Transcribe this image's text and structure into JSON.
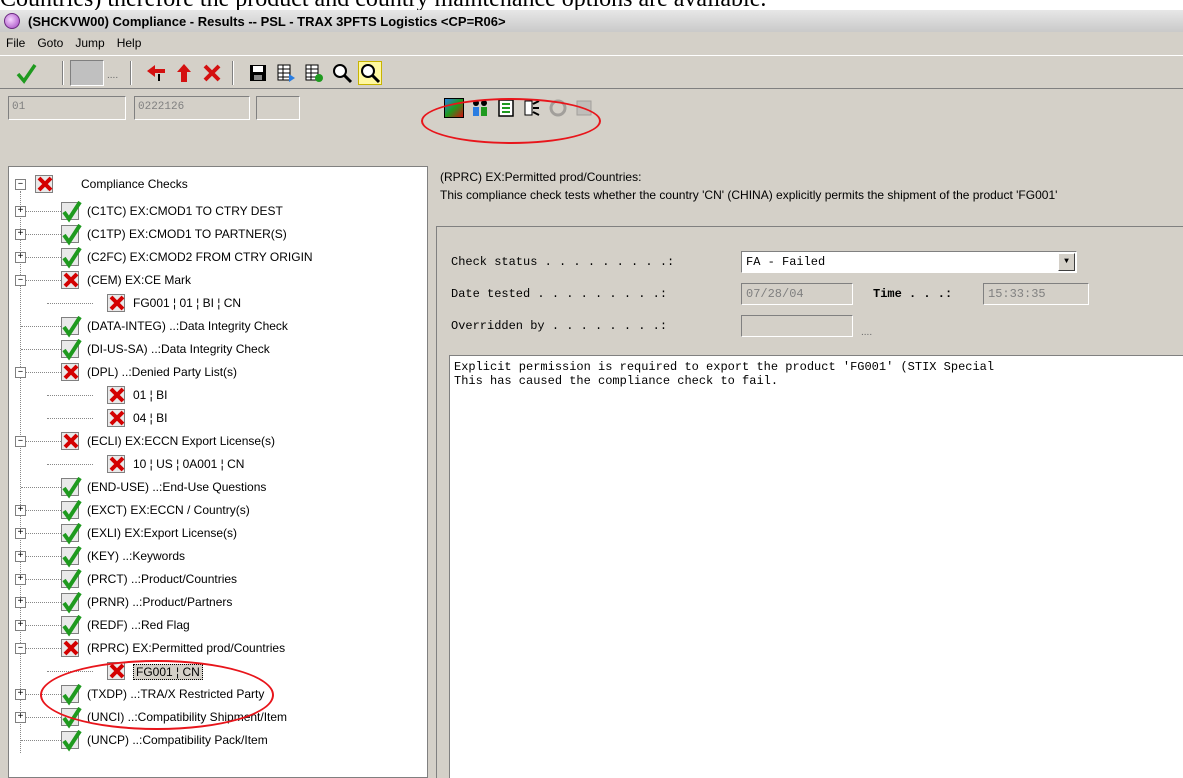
{
  "doc_caption": "Countries) therefore the product and country maintenance options are available.",
  "window": {
    "title": "(SHCKVW00) Compliance - Results -- PSL - TRAX 3PFTS Logistics <CP=R06>"
  },
  "menu": [
    "File",
    "Goto",
    "Jump",
    "Help"
  ],
  "toolbar": {
    "ellipsis": "...."
  },
  "header_fields": {
    "field1": "01",
    "field2": "0222126",
    "field3": ""
  },
  "tree": {
    "root": "Compliance Checks",
    "items": [
      {
        "label": "(C1TC) EX:CMOD1 TO CTRY DEST",
        "status": "pass",
        "expander": "+",
        "depth": 1
      },
      {
        "label": "(C1TP) EX:CMOD1 TO PARTNER(S)",
        "status": "pass",
        "expander": "+",
        "depth": 1
      },
      {
        "label": "(C2FC) EX:CMOD2 FROM CTRY ORIGIN",
        "status": "pass",
        "expander": "+",
        "depth": 1
      },
      {
        "label": "(CEM) EX:CE Mark",
        "status": "fail",
        "expander": "-",
        "depth": 1
      },
      {
        "label": "FG001 ¦ 01 ¦ BI ¦ CN",
        "status": "fail",
        "expander": "",
        "depth": 2
      },
      {
        "label": "(DATA-INTEG) ..:Data Integrity Check",
        "status": "pass",
        "expander": "",
        "depth": 1
      },
      {
        "label": "(DI-US-SA) ..:Data Integrity Check",
        "status": "pass",
        "expander": "",
        "depth": 1
      },
      {
        "label": "(DPL) ..:Denied Party List(s)",
        "status": "fail",
        "expander": "-",
        "depth": 1
      },
      {
        "label": "01 ¦ BI",
        "status": "fail",
        "expander": "",
        "depth": 2
      },
      {
        "label": "04 ¦ BI",
        "status": "fail",
        "expander": "",
        "depth": 2
      },
      {
        "label": "(ECLI) EX:ECCN Export License(s)",
        "status": "fail",
        "expander": "-",
        "depth": 1
      },
      {
        "label": "10 ¦ US ¦ 0A001 ¦ CN",
        "status": "fail",
        "expander": "",
        "depth": 2
      },
      {
        "label": "(END-USE) ..:End-Use Questions",
        "status": "pass",
        "expander": "",
        "depth": 1
      },
      {
        "label": "(EXCT) EX:ECCN / Country(s)",
        "status": "pass",
        "expander": "+",
        "depth": 1
      },
      {
        "label": "(EXLI) EX:Export License(s)",
        "status": "pass",
        "expander": "+",
        "depth": 1
      },
      {
        "label": "(KEY) ..:Keywords",
        "status": "pass",
        "expander": "+",
        "depth": 1
      },
      {
        "label": "(PRCT) ..:Product/Countries",
        "status": "pass",
        "expander": "+",
        "depth": 1
      },
      {
        "label": "(PRNR) ..:Product/Partners",
        "status": "pass",
        "expander": "+",
        "depth": 1
      },
      {
        "label": "(REDF) ..:Red Flag",
        "status": "pass",
        "expander": "+",
        "depth": 1
      },
      {
        "label": "(RPRC) EX:Permitted prod/Countries",
        "status": "fail",
        "expander": "-",
        "depth": 1
      },
      {
        "label": "FG001 ¦ CN",
        "status": "fail",
        "expander": "",
        "depth": 2,
        "selected": true
      },
      {
        "label": "(TXDP) ..:TRA/X Restricted Party",
        "status": "pass",
        "expander": "+",
        "depth": 1
      },
      {
        "label": "(UNCI) ..:Compatibility Shipment/Item",
        "status": "pass",
        "expander": "+",
        "depth": 1
      },
      {
        "label": "(UNCP) ..:Compatibility Pack/Item",
        "status": "pass",
        "expander": "",
        "depth": 1
      }
    ]
  },
  "detail": {
    "heading": "(RPRC) EX:Permitted prod/Countries:",
    "description": "This compliance check tests whether the country 'CN' (CHINA) explicitly permits the shipment of the product 'FG001'",
    "check_status_label": "Check status . . . . . . . . .:",
    "check_status_value": "FA - Failed",
    "date_tested_label": "Date tested  . . . . . . . . .:",
    "date_tested_value": "07/28/04",
    "time_label": "Time . . .:",
    "time_value": "15:33:35",
    "overridden_by_label": "Overridden by . . . . . . . .:",
    "overridden_by_value": "",
    "overridden_ellipsis": "....",
    "message_line1": "Explicit permission is required to export the product 'FG001' (STIX Special",
    "message_line2": "This has caused the compliance check to fail."
  },
  "colors": {
    "highlight": "#e8151b",
    "pass_check": "#1f9a1f",
    "fail_cross": "#d40000"
  }
}
